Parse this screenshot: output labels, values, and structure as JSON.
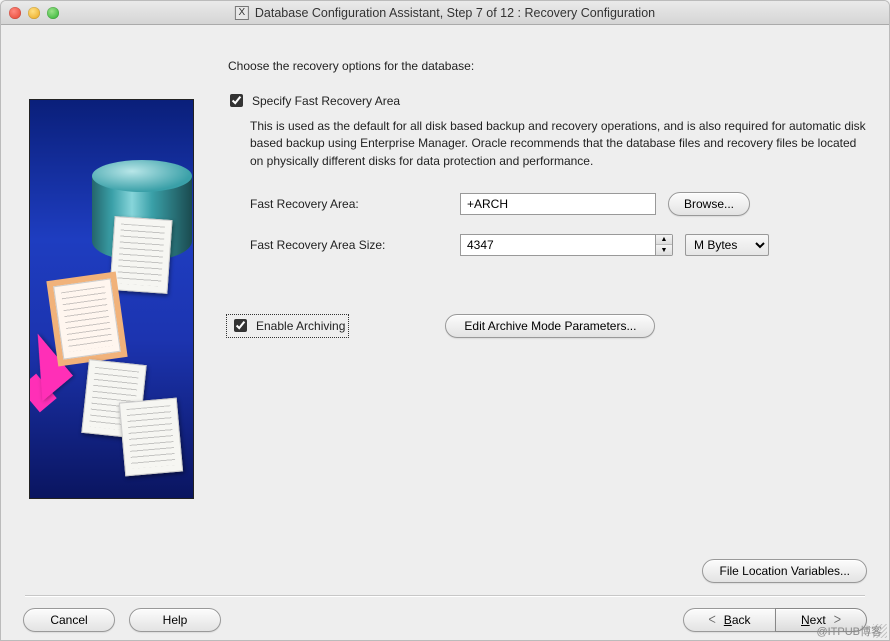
{
  "window": {
    "title": "Database Configuration Assistant, Step 7 of 12 : Recovery Configuration"
  },
  "main": {
    "prompt": "Choose the recovery options for the database:",
    "specify_checkbox_label": "Specify Fast Recovery Area",
    "specify_description": "This is used as the default for all disk based backup and recovery operations, and is also required for automatic disk based backup using Enterprise Manager. Oracle recommends that the database files and recovery files be located on physically different disks for data protection and performance.",
    "fra_label": "Fast Recovery Area:",
    "fra_value": "+ARCH",
    "browse_label": "Browse...",
    "fra_size_label": "Fast Recovery Area Size:",
    "fra_size_value": "4347",
    "unit_selected": "M Bytes",
    "enable_archiving_label": "Enable Archiving",
    "edit_archive_label": "Edit Archive Mode Parameters..."
  },
  "bottom": {
    "file_location_variables": "File Location Variables..."
  },
  "nav": {
    "cancel": "Cancel",
    "help": "Help",
    "back_prefix": "B",
    "back_rest": "ack",
    "next_prefix": "N",
    "next_rest": "ext"
  },
  "watermark": "@ITPUB博客"
}
